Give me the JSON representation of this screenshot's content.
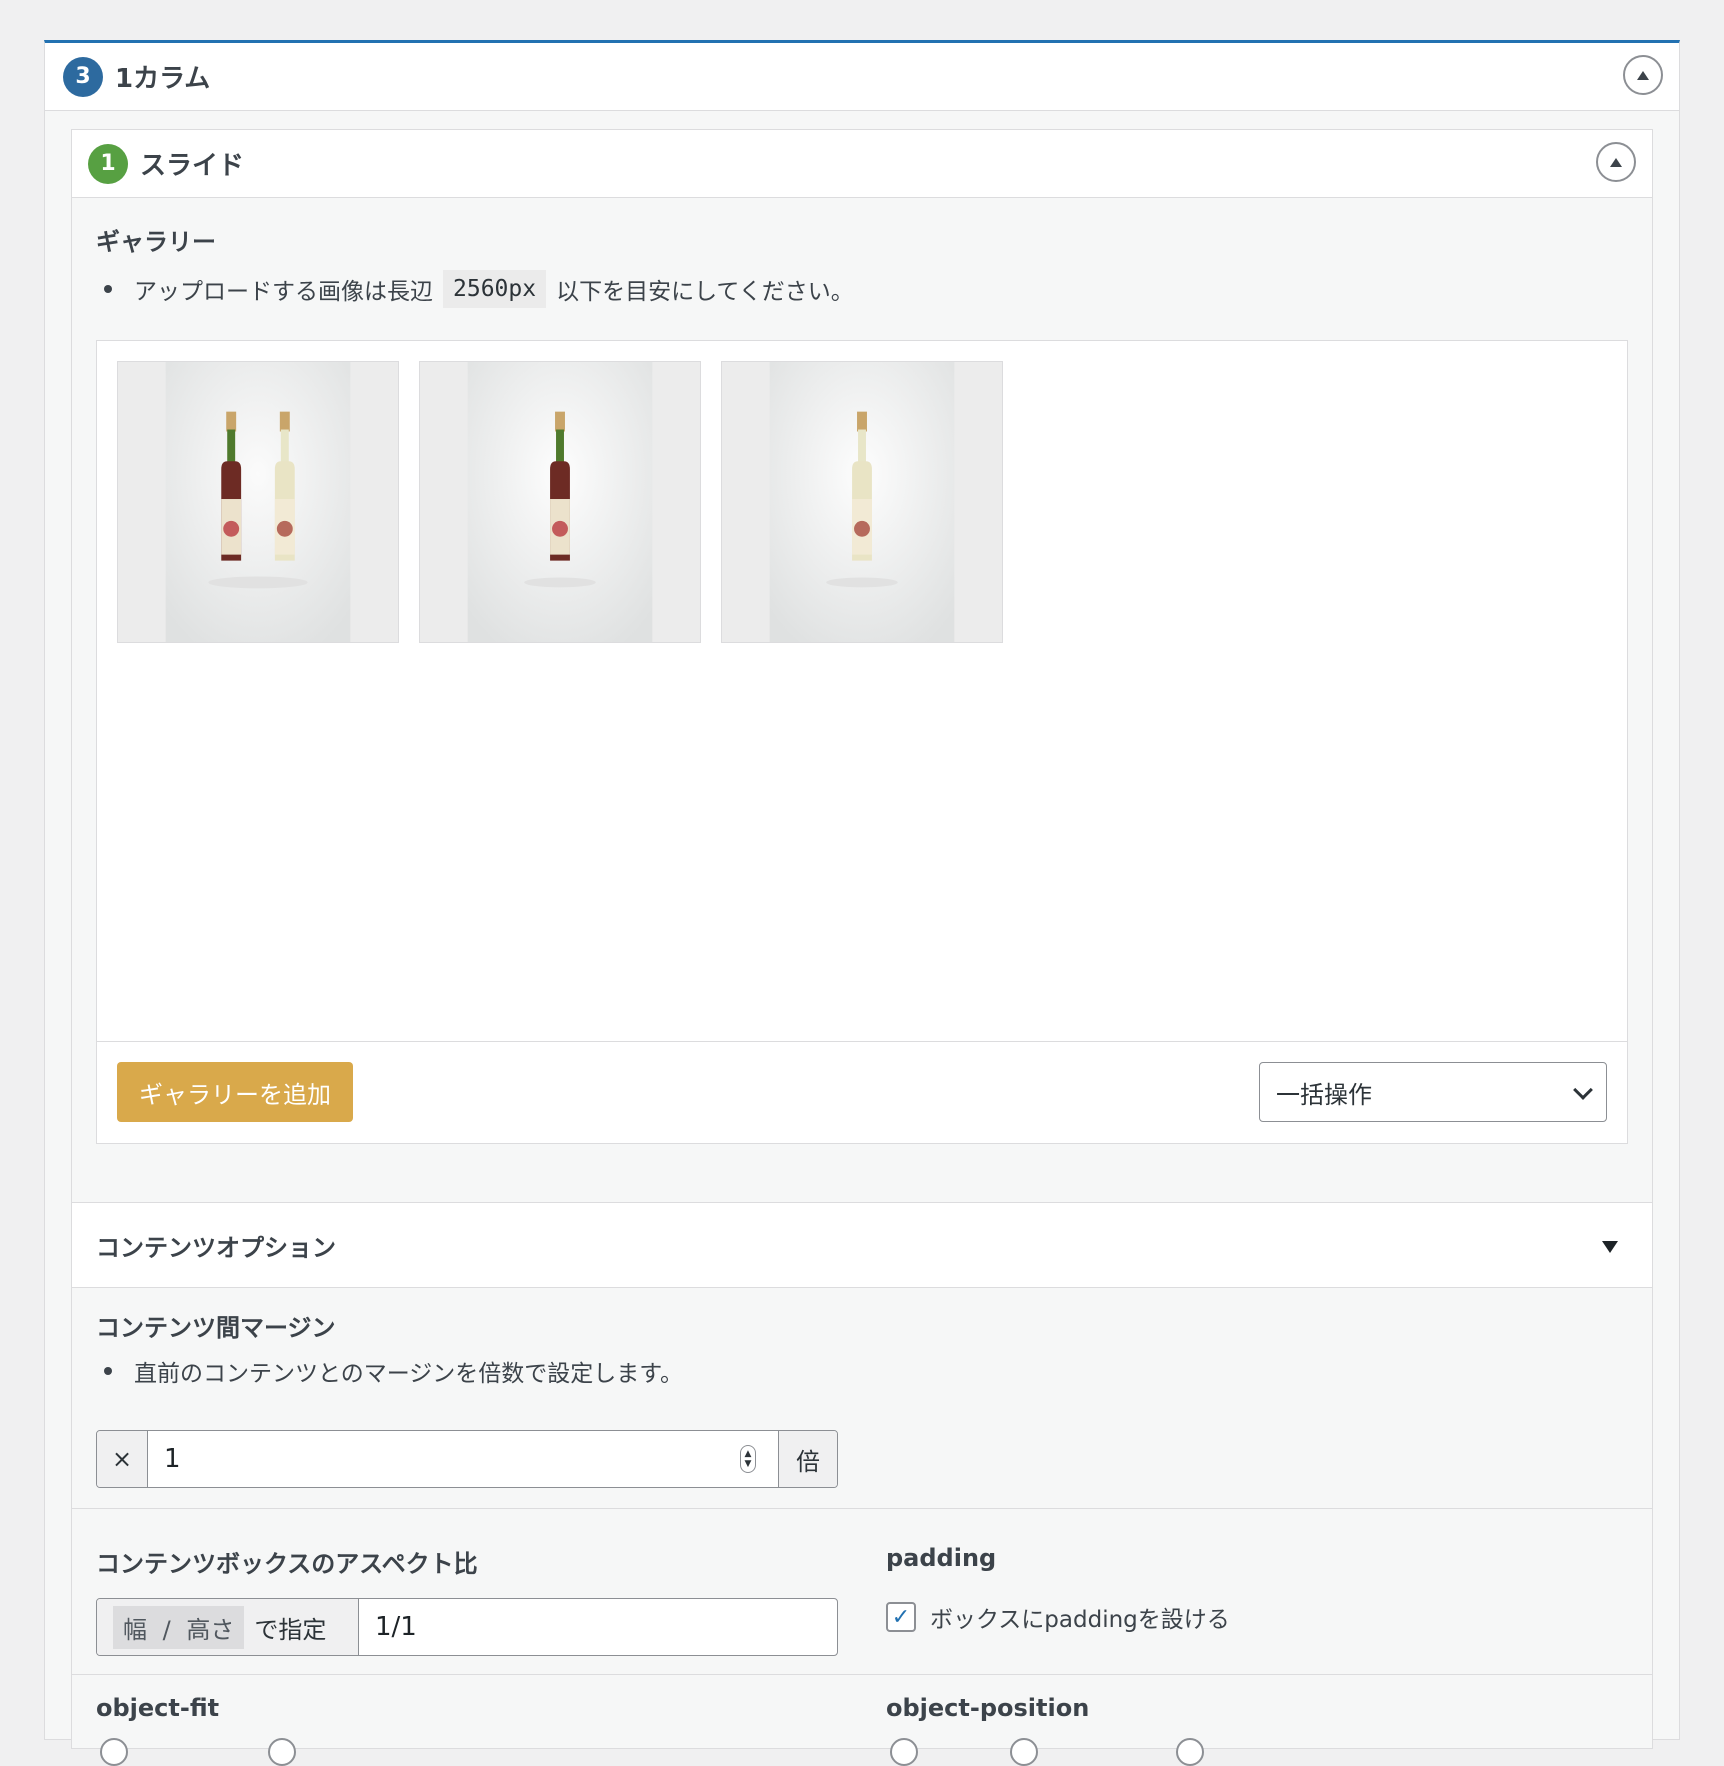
{
  "outer_block": {
    "badge": "3",
    "title": "1カラム"
  },
  "inner_block": {
    "badge": "1",
    "title": "スライド"
  },
  "gallery": {
    "label": "ギャラリー",
    "note_before": "アップロードする画像は長辺",
    "note_code": "2560px",
    "note_after": "以下を目安にしてください。",
    "thumbnails": [
      {
        "alt": "two-bottles"
      },
      {
        "alt": "red-bottle"
      },
      {
        "alt": "white-bottle"
      }
    ],
    "add_button": "ギャラリーを追加",
    "bulk_select": "一括操作"
  },
  "content_options": {
    "header": "コンテンツオプション"
  },
  "margin": {
    "label": "コンテンツ間マージン",
    "note": "直前のコンテンツとのマージンを倍数で設定します。",
    "prefix": "×",
    "value": "1",
    "suffix": "倍"
  },
  "aspect": {
    "label": "コンテンツボックスのアスペクト比",
    "chip": "幅 / 高さ",
    "suffix": "で指定",
    "value": "1/1"
  },
  "padding": {
    "label": "padding",
    "checkbox_label": "ボックスにpaddingを設ける",
    "checked": true
  },
  "object_fit": {
    "label": "object-fit"
  },
  "object_position": {
    "label": "object-position"
  }
}
